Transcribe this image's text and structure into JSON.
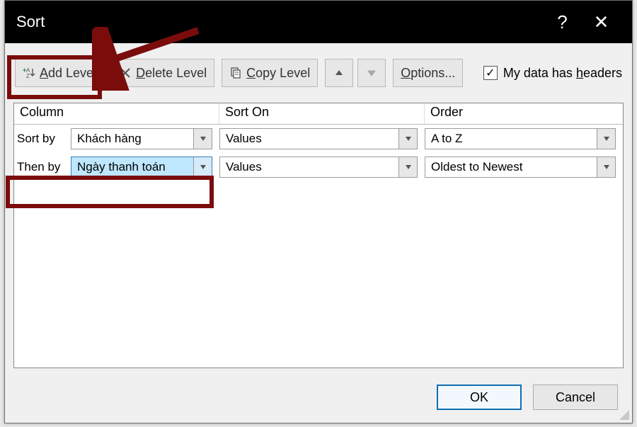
{
  "title": "Sort",
  "toolbar": {
    "add_level": "Add Level",
    "delete_level": "Delete Level",
    "copy_level": "Copy Level",
    "options": "Options...",
    "headers": "My data has headers"
  },
  "headers": {
    "column": "Column",
    "sort_on": "Sort On",
    "order": "Order"
  },
  "rows": [
    {
      "label": "Sort by",
      "column_value": "Khách hàng",
      "sorton_value": "Values",
      "order_value": "A to Z"
    },
    {
      "label": "Then by",
      "column_value": "Ngày thanh toán",
      "sorton_value": "Values",
      "order_value": "Oldest to Newest"
    }
  ],
  "buttons": {
    "ok": "OK",
    "cancel": "Cancel"
  }
}
